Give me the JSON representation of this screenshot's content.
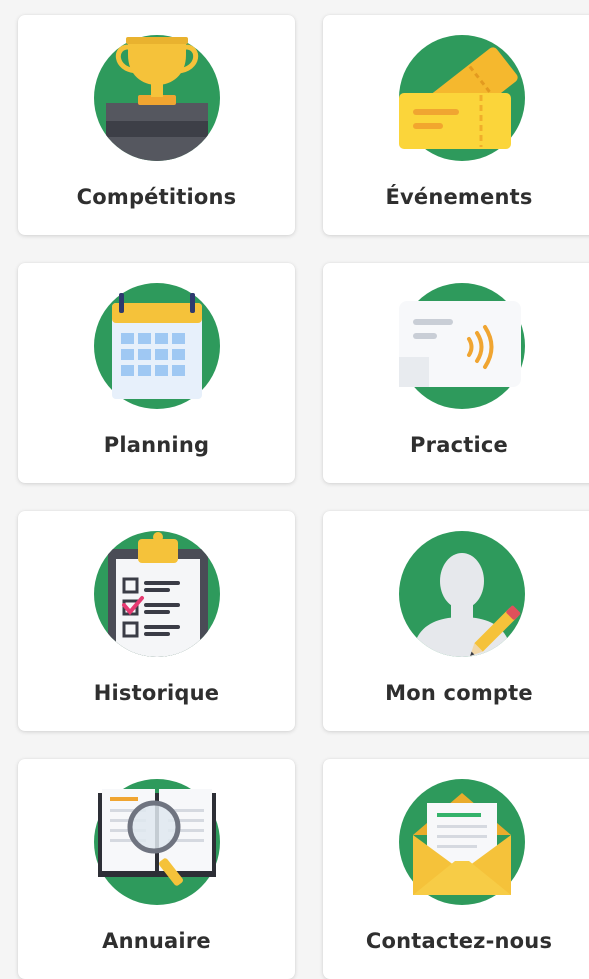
{
  "colors": {
    "circle": "#2e9a5c",
    "label": "#2f2f2f",
    "card": "#ffffff",
    "background": "#f5f5f5"
  },
  "tiles": [
    {
      "label": "Compétitions",
      "icon": "trophy-icon"
    },
    {
      "label": "Événements",
      "icon": "tickets-icon"
    },
    {
      "label": "Planning",
      "icon": "calendar-icon"
    },
    {
      "label": "Practice",
      "icon": "contactless-card-icon"
    },
    {
      "label": "Historique",
      "icon": "checklist-clipboard-icon"
    },
    {
      "label": "Mon compte",
      "icon": "user-edit-icon"
    },
    {
      "label": "Annuaire",
      "icon": "directory-book-icon"
    },
    {
      "label": "Contactez-nous",
      "icon": "envelope-icon"
    }
  ]
}
